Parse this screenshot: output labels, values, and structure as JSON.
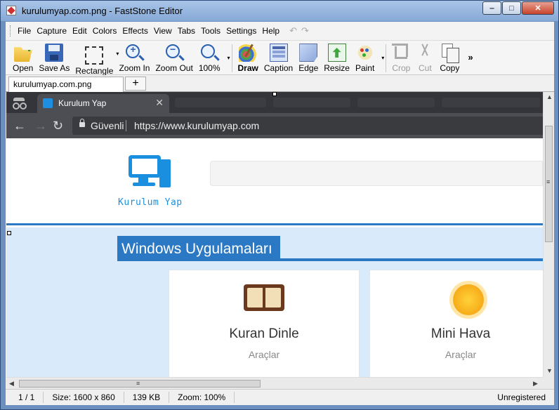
{
  "window": {
    "title": "kurulumyap.com.png - FastStone Editor",
    "minimize": "‒",
    "maximize": "□",
    "close": "✕"
  },
  "menu": [
    "File",
    "Capture",
    "Edit",
    "Colors",
    "Effects",
    "View",
    "Tabs",
    "Tools",
    "Settings",
    "Help"
  ],
  "undo_glyphs": {
    "undo": "↶",
    "redo": "↷"
  },
  "toolbar": {
    "open": "Open",
    "save_as": "Save As",
    "rectangle": "Rectangle",
    "zoom_in": "Zoom In",
    "zoom_out": "Zoom Out",
    "zoom_level": "100%",
    "draw": "Draw",
    "caption": "Caption",
    "edge": "Edge",
    "resize": "Resize",
    "paint": "Paint",
    "crop": "Crop",
    "cut": "Cut",
    "copy": "Copy",
    "more": "»",
    "dropdown": "▾"
  },
  "doc_tab": {
    "label": "kurulumyap.com.png",
    "new_tab": "+"
  },
  "browser": {
    "tab_title": "Kurulum Yap",
    "tab_close": "✕",
    "back": "←",
    "forward": "→",
    "reload": "↻",
    "secure_label": "Güvenli",
    "url": "https://www.kurulumyap.com"
  },
  "site": {
    "logo_text": "Kurulum Yap",
    "section_title": "Windows Uygulamaları",
    "cards": [
      {
        "name": "Kuran Dinle",
        "category": "Araçlar"
      },
      {
        "name": "Mini Hava",
        "category": "Araçlar"
      }
    ]
  },
  "scroll": {
    "up": "▲",
    "down": "▼",
    "left": "◀",
    "right": "▶",
    "grip": "≡"
  },
  "status": {
    "page": "1 / 1",
    "size": "Size: 1600 x 860",
    "file_size": "139 KB",
    "zoom": "Zoom: 100%",
    "registration": "Unregistered"
  },
  "colors": {
    "accent": "#2b78c4",
    "logo": "#1a8fe0",
    "section_bg": "#d9ebfb",
    "chrome_dark": "#34353a"
  }
}
